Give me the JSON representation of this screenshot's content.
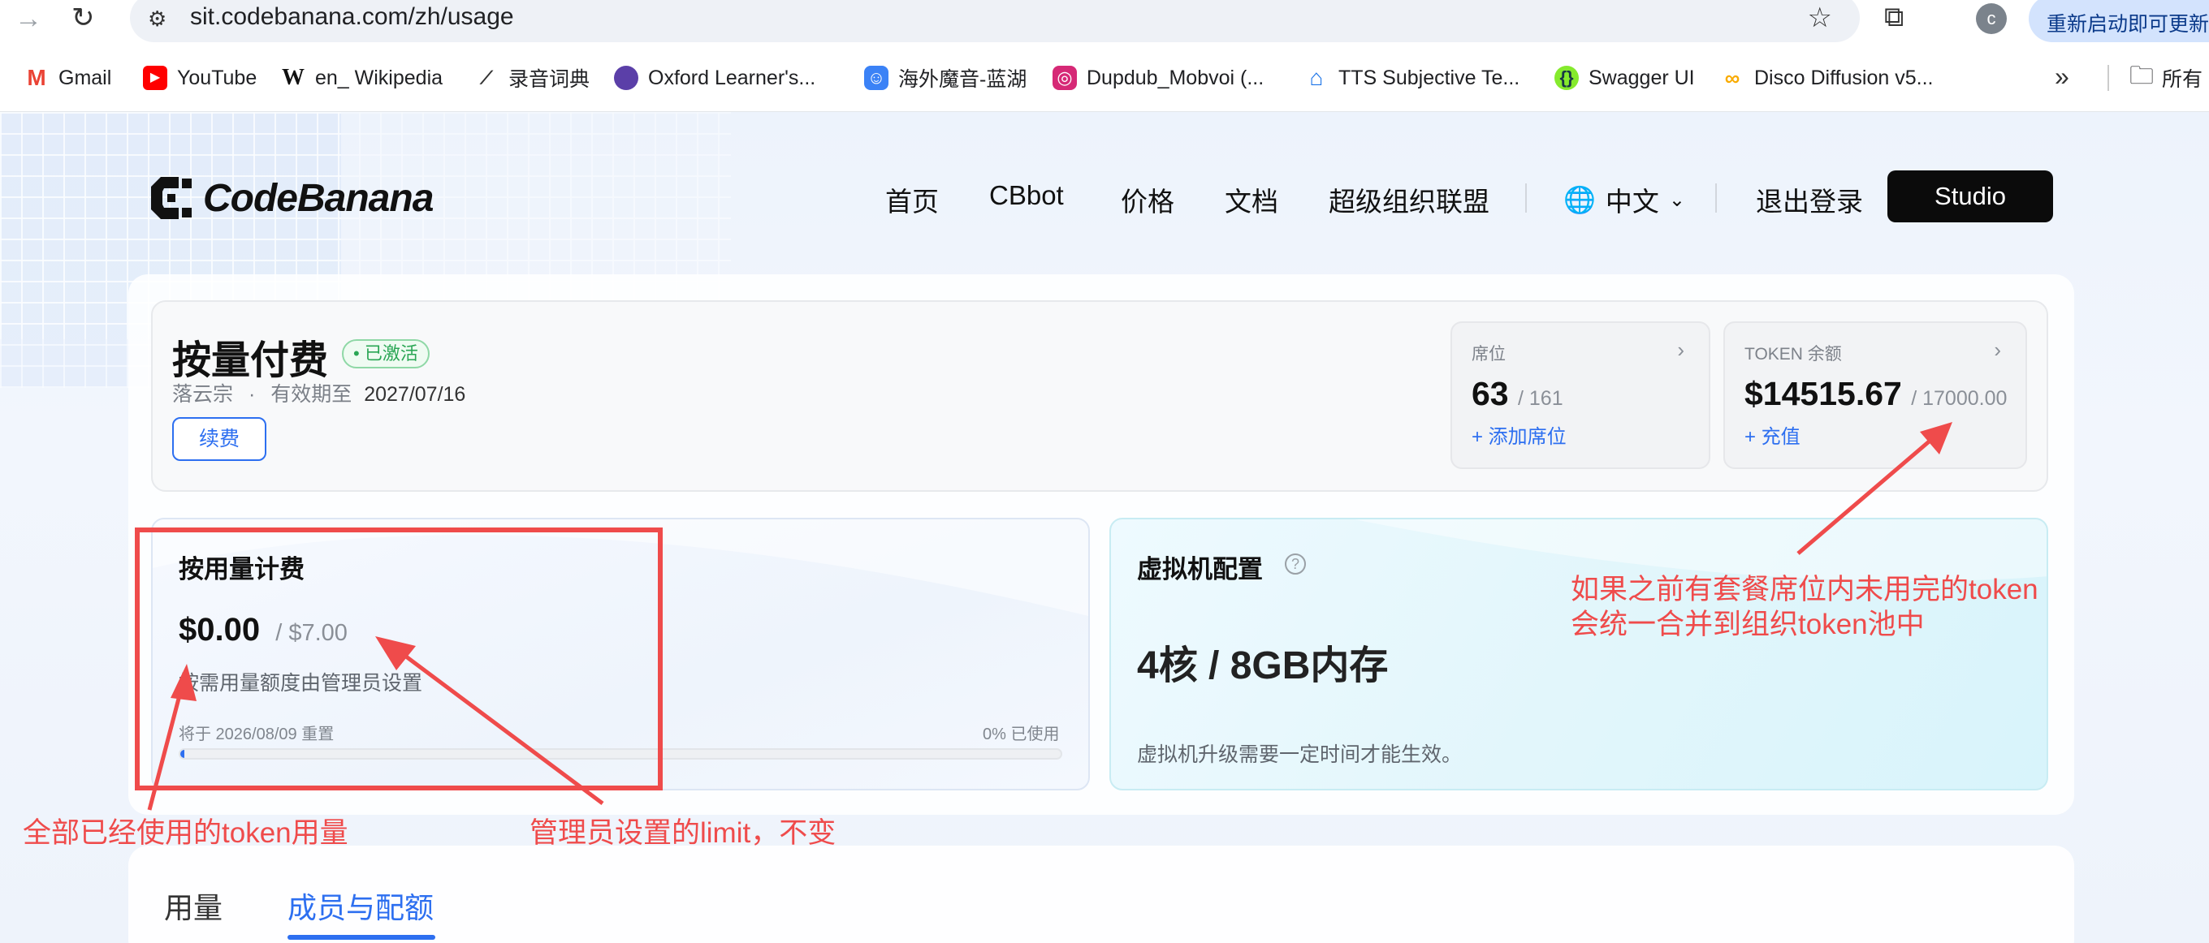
{
  "browser": {
    "url": "sit.codebanana.com/zh/usage",
    "profile_initial": "c",
    "update_label": "重新启动即可更新",
    "bookmarks": [
      {
        "label": "Gmail"
      },
      {
        "label": "YouTube"
      },
      {
        "label": "en_ Wikipedia"
      },
      {
        "label": "录音词典"
      },
      {
        "label": "Oxford Learner's..."
      },
      {
        "label": "海外魔音-蓝湖"
      },
      {
        "label": "Dupdub_Mobvoi (..."
      },
      {
        "label": "TTS Subjective Te..."
      },
      {
        "label": "Swagger UI"
      },
      {
        "label": "Disco Diffusion v5..."
      }
    ],
    "overflow": "»",
    "folder_label": "所有"
  },
  "site": {
    "logo_text": "CodeBanana",
    "nav": [
      "首页",
      "CBbot",
      "价格",
      "文档",
      "超级组织联盟"
    ],
    "lang_label": "中文",
    "logout_label": "退出登录",
    "studio_label": "Studio"
  },
  "plan": {
    "title": "按量付费",
    "badge": "• 已激活",
    "org_name": "落云宗",
    "dot": "·",
    "valid_label": "有效期至",
    "valid_date": "2027/07/16",
    "renew_label": "续费"
  },
  "seats": {
    "label": "席位",
    "used": "63",
    "total": "/ 161",
    "link": "+ 添加席位"
  },
  "token": {
    "label": "TOKEN 余额",
    "balance": "$14515.67",
    "total": "/ 17000.00",
    "link": "+ 充值"
  },
  "usage": {
    "title": "按用量计费",
    "amount": "$0.00",
    "limit": "/ $7.00",
    "desc": "按需用量额度由管理员设置",
    "reset": "将于 2026/08/09 重置",
    "used_text": "0% 已使用",
    "progress_fraction": 0.0
  },
  "vm": {
    "title": "虚拟机配置",
    "help": "?",
    "spec": "4核 / 8GB内存",
    "note": "虚拟机升级需要一定时间才能生效。"
  },
  "tabs": [
    {
      "label": "用量",
      "active": false
    },
    {
      "label": "成员与配额",
      "active": true
    }
  ],
  "annotations": {
    "token_used": "全部已经使用的token用量",
    "admin_limit": "管理员设置的limit，不变",
    "merge_note_1": "如果之前有套餐席位内未用完的token",
    "merge_note_2": "会统一合并到组织token池中"
  },
  "colors": {
    "accent": "#2d6ff0",
    "annotation": "#ef4b4b",
    "active_badge": "#2aa654",
    "studio_button": "#0b0b0b"
  }
}
